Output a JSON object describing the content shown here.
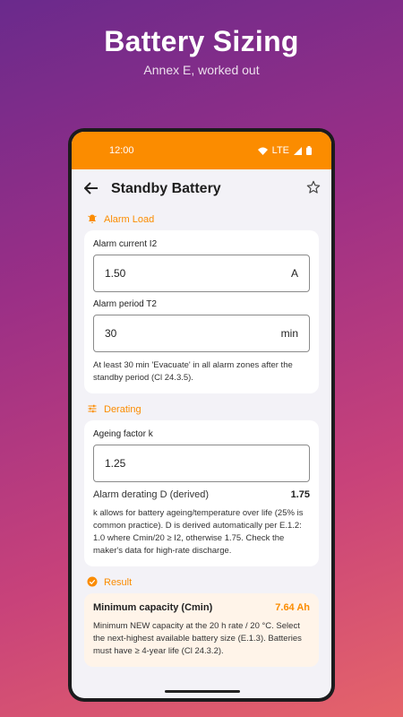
{
  "promo": {
    "title": "Battery Sizing",
    "subtitle": "Annex E, worked out"
  },
  "statusbar": {
    "time": "12:00",
    "network": "LTE"
  },
  "appbar": {
    "title": "Standby Battery",
    "back_icon": "arrow-left-icon",
    "favorite_icon": "star-outline-icon"
  },
  "alarm_load": {
    "header": "Alarm Load",
    "icon": "bell-icon",
    "current_label": "Alarm current I2",
    "current_value": "1.50",
    "current_unit": "A",
    "period_label": "Alarm period T2",
    "period_value": "30",
    "period_unit": "min",
    "help": "At least 30 min 'Evacuate' in all alarm zones after the standby period (Cl 24.3.5)."
  },
  "derating": {
    "header": "Derating",
    "icon": "sliders-icon",
    "ageing_label": "Ageing factor k",
    "ageing_value": "1.25",
    "derived_label": "Alarm derating D (derived)",
    "derived_value": "1.75",
    "help": "k allows for battery ageing/temperature over life (25% is common practice). D is derived automatically per E.1.2: 1.0 where Cmin/20 ≥ I2, otherwise 1.75. Check the maker's data for high-rate discharge."
  },
  "result": {
    "header": "Result",
    "icon": "check-circle-icon",
    "label": "Minimum capacity (Cmin)",
    "value": "7.64 Ah",
    "help": "Minimum NEW capacity at the 20 h rate / 20 °C. Select the next-highest available battery size (E.1.3). Batteries must have ≥ 4-year life (Cl 24.3.2)."
  },
  "colors": {
    "accent": "#fb8c00",
    "background": "#f3f2f7"
  }
}
